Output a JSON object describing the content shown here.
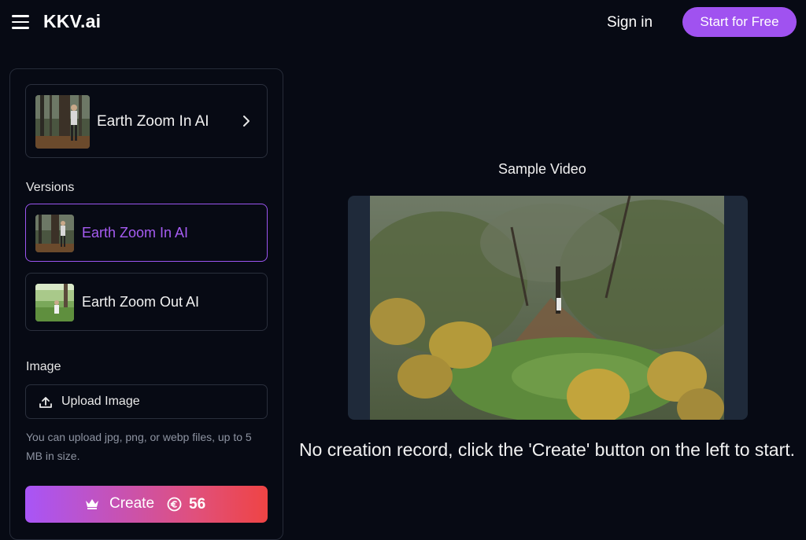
{
  "header": {
    "logo": "KKV.ai",
    "sign_in": "Sign in",
    "start_free": "Start for Free",
    "accent": "#a052f0"
  },
  "sidebar": {
    "model": {
      "label": "Earth Zoom In AI"
    },
    "versions_label": "Versions",
    "versions": [
      {
        "label": "Earth Zoom In AI",
        "active": true
      },
      {
        "label": "Earth Zoom Out AI",
        "active": false
      }
    ],
    "image_label": "Image",
    "upload_label": "Upload Image",
    "upload_hint": "You can upload jpg, png, or webp files, up to 5 MB in size.",
    "create_label": "Create",
    "credits": "56"
  },
  "main": {
    "sample_title": "Sample Video",
    "empty_message": "No creation record, click the 'Create' button on the left to start."
  }
}
